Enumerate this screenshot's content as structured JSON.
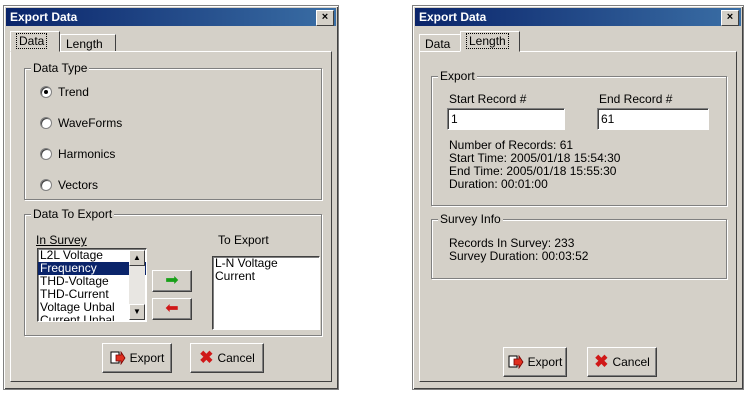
{
  "left": {
    "title": "Export Data",
    "close": "×",
    "tabs": [
      "Data",
      "Length"
    ],
    "data_type": {
      "legend": "Data Type",
      "options": [
        {
          "label": "Trend",
          "checked": true
        },
        {
          "label": "WaveForms",
          "checked": false
        },
        {
          "label": "Harmonics",
          "checked": false
        },
        {
          "label": "Vectors",
          "checked": false
        }
      ]
    },
    "data_to_export": {
      "legend": "Data To Export",
      "in_survey_label": "In Survey",
      "to_export_label": "To Export",
      "in_survey_items": [
        "L2L Voltage",
        "Frequency",
        "THD-Voltage",
        "THD-Current",
        "Voltage Unbal",
        "Current Unbal"
      ],
      "selected_index": 1,
      "to_export_items": [
        "L-N Voltage",
        "Current"
      ]
    },
    "buttons": {
      "export": "Export",
      "cancel": "Cancel"
    }
  },
  "right": {
    "title": "Export Data",
    "close": "×",
    "tabs": [
      "Data",
      "Length"
    ],
    "export_group": {
      "legend": "Export",
      "start_label": "Start Record #",
      "end_label": "End Record #",
      "start_value": "1",
      "end_value": "61",
      "number_of_records": "Number of Records: 61",
      "start_time": "Start Time: 2005/01/18 15:54:30",
      "end_time": "End Time: 2005/01/18 15:55:30",
      "duration": "Duration: 00:01:00"
    },
    "survey_info": {
      "legend": "Survey Info",
      "records": "Records In Survey: 233",
      "duration": "Survey Duration: 00:03:52"
    },
    "buttons": {
      "export": "Export",
      "cancel": "Cancel"
    }
  }
}
